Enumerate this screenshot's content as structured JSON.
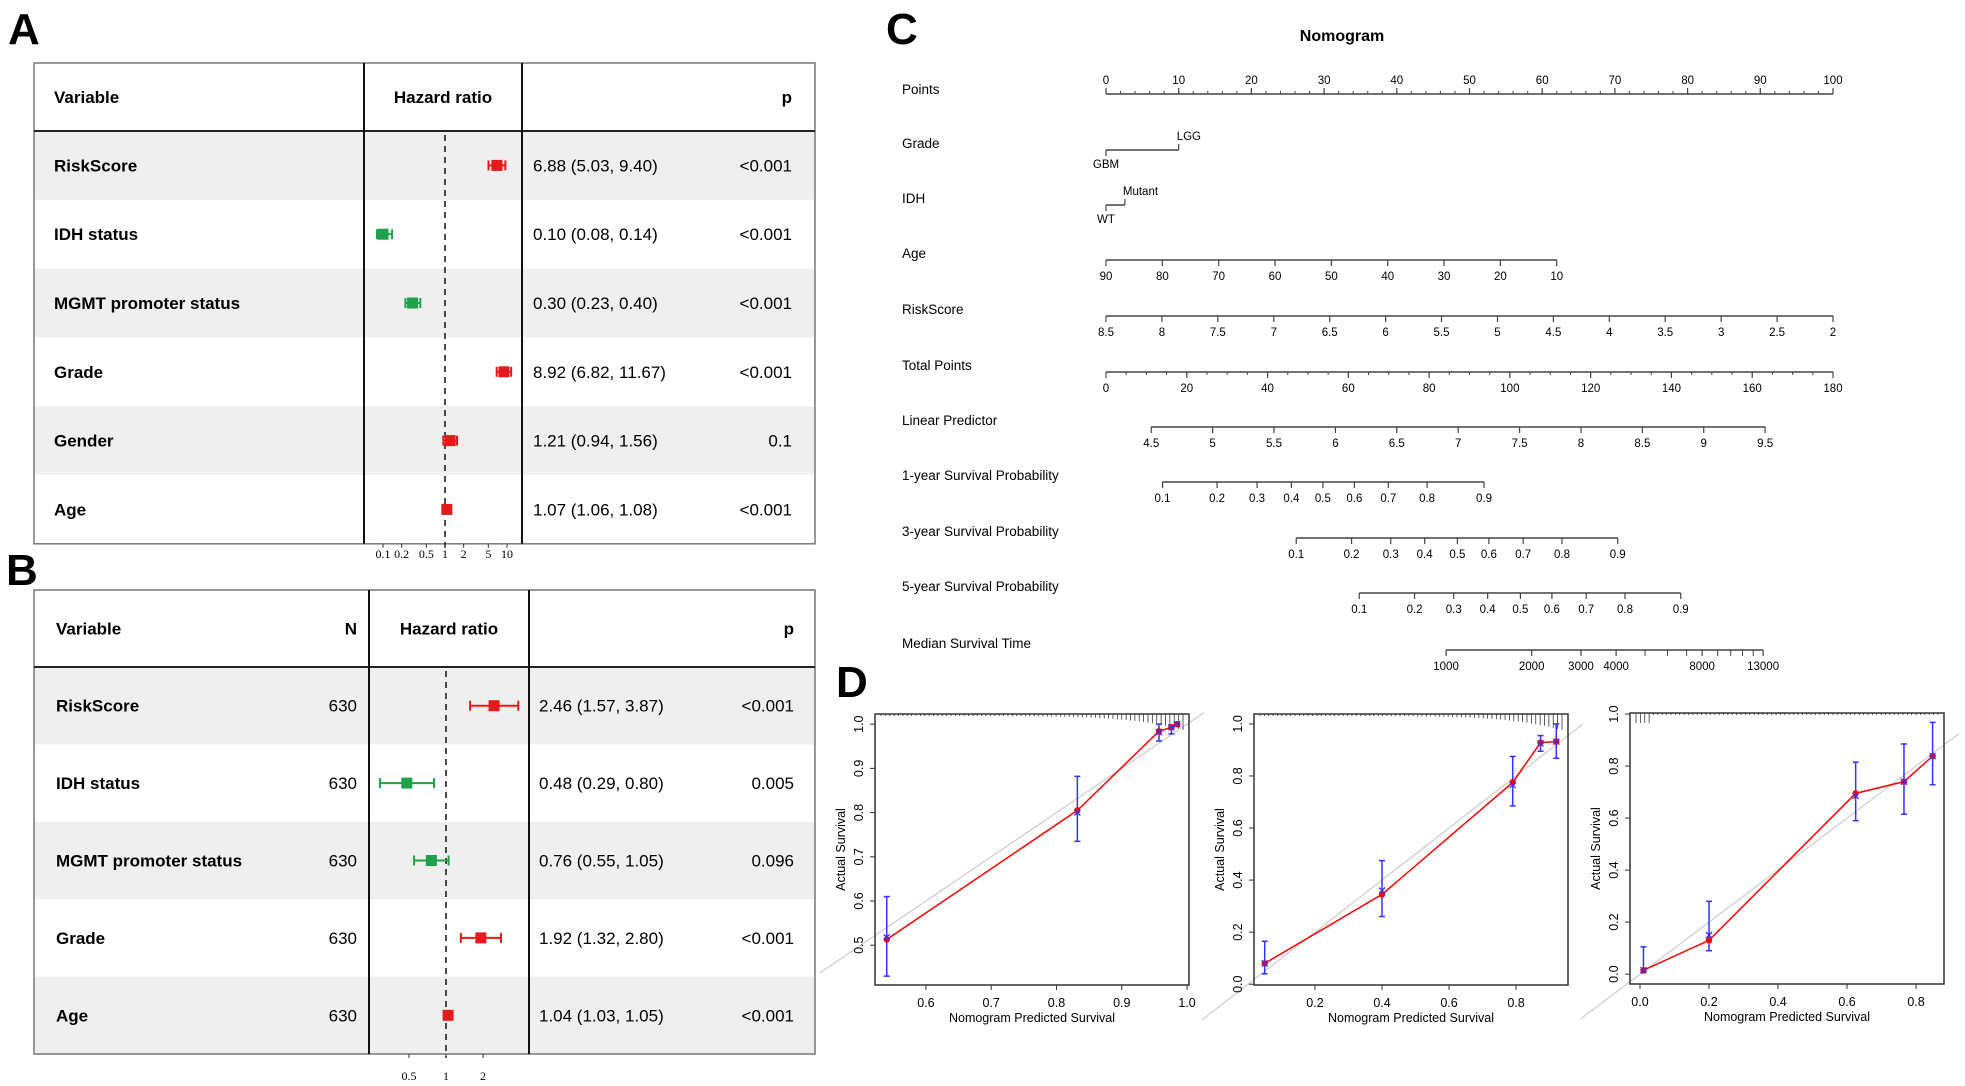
{
  "panel_labels": {
    "a": "A",
    "b": "B",
    "c": "C",
    "d": "D"
  },
  "colors": {
    "risk": "#e41a1c",
    "protective": "#1fa04a",
    "row_shade": "#efefef",
    "calib_line": "#ff0000",
    "calib_ci": "#3333ff",
    "ideal_line": "#cccccc"
  },
  "chart_data": [
    {
      "type": "forest",
      "panel": "A",
      "columns": {
        "variable": "Variable",
        "hr": "Hazard ratio",
        "p": "p"
      },
      "xscale": "log",
      "xticks": [
        0.1,
        0.2,
        0.5,
        1,
        2,
        5,
        10
      ],
      "xtick_labels": [
        "0.1",
        "0.2",
        "0.5",
        "1",
        "2",
        "5",
        "10"
      ],
      "reference": 1,
      "rows": [
        {
          "variable": "RiskScore",
          "hr": 6.88,
          "lower": 5.03,
          "upper": 9.4,
          "estimate": "6.88 (5.03, 9.40)",
          "p": "<0.001",
          "color": "#e41a1c"
        },
        {
          "variable": "IDH status",
          "hr": 0.1,
          "lower": 0.08,
          "upper": 0.14,
          "estimate": "0.10 (0.08, 0.14)",
          "p": "<0.001",
          "color": "#1fa04a"
        },
        {
          "variable": "MGMT promoter status",
          "hr": 0.3,
          "lower": 0.23,
          "upper": 0.4,
          "estimate": "0.30 (0.23, 0.40)",
          "p": "<0.001",
          "color": "#1fa04a"
        },
        {
          "variable": "Grade",
          "hr": 8.92,
          "lower": 6.82,
          "upper": 11.67,
          "estimate": "8.92 (6.82, 11.67)",
          "p": "<0.001",
          "color": "#e41a1c"
        },
        {
          "variable": "Gender",
          "hr": 1.21,
          "lower": 0.94,
          "upper": 1.56,
          "estimate": "1.21 (0.94, 1.56)",
          "p": "0.1",
          "color": "#e41a1c"
        },
        {
          "variable": "Age",
          "hr": 1.07,
          "lower": 1.06,
          "upper": 1.08,
          "estimate": "1.07 (1.06, 1.08)",
          "p": "<0.001",
          "color": "#e41a1c"
        }
      ]
    },
    {
      "type": "forest",
      "panel": "B",
      "columns": {
        "variable": "Variable",
        "n": "N",
        "hr": "Hazard ratio",
        "p": "p"
      },
      "xscale": "log",
      "xticks": [
        0.5,
        1,
        2
      ],
      "xtick_labels": [
        "0.5",
        "1",
        "2"
      ],
      "reference": 1,
      "rows": [
        {
          "variable": "RiskScore",
          "n": "630",
          "hr": 2.46,
          "lower": 1.57,
          "upper": 3.87,
          "estimate": "2.46 (1.57, 3.87)",
          "p": "<0.001",
          "color": "#e41a1c"
        },
        {
          "variable": "IDH status",
          "n": "630",
          "hr": 0.48,
          "lower": 0.29,
          "upper": 0.8,
          "estimate": "0.48 (0.29, 0.80)",
          "p": "0.005",
          "color": "#1fa04a"
        },
        {
          "variable": "MGMT promoter status",
          "n": "630",
          "hr": 0.76,
          "lower": 0.55,
          "upper": 1.05,
          "estimate": "0.76 (0.55, 1.05)",
          "p": "0.096",
          "color": "#1fa04a"
        },
        {
          "variable": "Grade",
          "n": "630",
          "hr": 1.92,
          "lower": 1.32,
          "upper": 2.8,
          "estimate": "1.92 (1.32, 2.80)",
          "p": "<0.001",
          "color": "#e41a1c"
        },
        {
          "variable": "Age",
          "n": "630",
          "hr": 1.04,
          "lower": 1.03,
          "upper": 1.05,
          "estimate": "1.04 (1.03, 1.05)",
          "p": "<0.001",
          "color": "#e41a1c"
        }
      ]
    },
    {
      "type": "nomogram",
      "panel": "C",
      "title": "Nomogram",
      "scales": [
        {
          "label": "Points",
          "axis": "points",
          "position": "above",
          "minor_step": 2,
          "ticks": [
            {
              "t": "0",
              "pts": 0
            },
            {
              "t": "10",
              "pts": 10
            },
            {
              "t": "20",
              "pts": 20
            },
            {
              "t": "30",
              "pts": 30
            },
            {
              "t": "40",
              "pts": 40
            },
            {
              "t": "50",
              "pts": 50
            },
            {
              "t": "60",
              "pts": 60
            },
            {
              "t": "70",
              "pts": 70
            },
            {
              "t": "80",
              "pts": 80
            },
            {
              "t": "90",
              "pts": 90
            },
            {
              "t": "100",
              "pts": 100
            }
          ]
        },
        {
          "label": "Grade",
          "axis": "points",
          "position": "categorical",
          "ticks": [
            {
              "t": "GBM",
              "pts": 0,
              "side": "below"
            },
            {
              "t": "LGG",
              "pts": 10,
              "side": "above"
            }
          ]
        },
        {
          "label": "IDH",
          "axis": "points",
          "position": "categorical",
          "ticks": [
            {
              "t": "WT",
              "pts": 0,
              "side": "below"
            },
            {
              "t": "Mutant",
              "pts": 2.6,
              "side": "above"
            }
          ]
        },
        {
          "label": "Age",
          "axis": "points",
          "position": "below",
          "ticks": [
            {
              "t": "90",
              "pts": 0
            },
            {
              "t": "80",
              "pts": 7.75
            },
            {
              "t": "70",
              "pts": 15.5
            },
            {
              "t": "60",
              "pts": 23.25
            },
            {
              "t": "50",
              "pts": 31
            },
            {
              "t": "40",
              "pts": 38.75
            },
            {
              "t": "30",
              "pts": 46.5
            },
            {
              "t": "20",
              "pts": 54.25
            },
            {
              "t": "10",
              "pts": 62
            }
          ]
        },
        {
          "label": "RiskScore",
          "axis": "points",
          "position": "below",
          "ticks": [
            {
              "t": "8.5",
              "pts": 0
            },
            {
              "t": "8",
              "pts": 7.69
            },
            {
              "t": "7.5",
              "pts": 15.38
            },
            {
              "t": "7",
              "pts": 23.08
            },
            {
              "t": "6.5",
              "pts": 30.77
            },
            {
              "t": "6",
              "pts": 38.46
            },
            {
              "t": "5.5",
              "pts": 46.15
            },
            {
              "t": "5",
              "pts": 53.85
            },
            {
              "t": "4.5",
              "pts": 61.54
            },
            {
              "t": "4",
              "pts": 69.23
            },
            {
              "t": "3.5",
              "pts": 76.92
            },
            {
              "t": "3",
              "pts": 84.62
            },
            {
              "t": "2.5",
              "pts": 92.31
            },
            {
              "t": "2",
              "pts": 100
            }
          ]
        },
        {
          "label": "Total Points",
          "axis": "total",
          "position": "below",
          "minor_step": 5,
          "ticks": [
            {
              "t": "0",
              "pts": 0
            },
            {
              "t": "20",
              "pts": 20
            },
            {
              "t": "40",
              "pts": 40
            },
            {
              "t": "60",
              "pts": 60
            },
            {
              "t": "80",
              "pts": 80
            },
            {
              "t": "100",
              "pts": 100
            },
            {
              "t": "120",
              "pts": 120
            },
            {
              "t": "140",
              "pts": 140
            },
            {
              "t": "160",
              "pts": 160
            },
            {
              "t": "180",
              "pts": 180
            }
          ]
        },
        {
          "label": "Linear Predictor",
          "axis": "total",
          "position": "below",
          "ticks": [
            {
              "t": "4.5",
              "pts": 11.2
            },
            {
              "t": "5",
              "pts": 26.4
            },
            {
              "t": "5.5",
              "pts": 41.6
            },
            {
              "t": "6",
              "pts": 56.8
            },
            {
              "t": "6.5",
              "pts": 72
            },
            {
              "t": "7",
              "pts": 87.2
            },
            {
              "t": "7.5",
              "pts": 102.4
            },
            {
              "t": "8",
              "pts": 117.6
            },
            {
              "t": "8.5",
              "pts": 132.8
            },
            {
              "t": "9",
              "pts": 148
            },
            {
              "t": "9.5",
              "pts": 163.2
            }
          ]
        },
        {
          "label": "1-year Survival Probability",
          "axis": "total",
          "position": "below",
          "ticks": [
            {
              "t": "0.1",
              "pts": 14
            },
            {
              "t": "0.2",
              "pts": 27.5
            },
            {
              "t": "0.3",
              "pts": 37.4
            },
            {
              "t": "0.4",
              "pts": 45.9
            },
            {
              "t": "0.5",
              "pts": 53.7
            },
            {
              "t": "0.6",
              "pts": 61.5
            },
            {
              "t": "0.7",
              "pts": 69.9
            },
            {
              "t": "0.8",
              "pts": 79.5
            },
            {
              "t": "0.9",
              "pts": 93.6
            }
          ]
        },
        {
          "label": "3-year Survival Probability",
          "axis": "total",
          "position": "below",
          "ticks": [
            {
              "t": "0.1",
              "pts": 47.1
            },
            {
              "t": "0.2",
              "pts": 60.8
            },
            {
              "t": "0.3",
              "pts": 70.5
            },
            {
              "t": "0.4",
              "pts": 78.9
            },
            {
              "t": "0.5",
              "pts": 87
            },
            {
              "t": "0.6",
              "pts": 94.8
            },
            {
              "t": "0.7",
              "pts": 103.3
            },
            {
              "t": "0.8",
              "pts": 112.9
            },
            {
              "t": "0.9",
              "pts": 126.7
            }
          ]
        },
        {
          "label": "5-year Survival Probability",
          "axis": "total",
          "position": "below",
          "ticks": [
            {
              "t": "0.1",
              "pts": 62.7
            },
            {
              "t": "0.2",
              "pts": 76.4
            },
            {
              "t": "0.3",
              "pts": 86.1
            },
            {
              "t": "0.4",
              "pts": 94.5
            },
            {
              "t": "0.5",
              "pts": 102.6
            },
            {
              "t": "0.6",
              "pts": 110.4
            },
            {
              "t": "0.7",
              "pts": 118.9
            },
            {
              "t": "0.8",
              "pts": 128.5
            },
            {
              "t": "0.9",
              "pts": 142.3
            }
          ]
        },
        {
          "label": "Median Survival Time",
          "axis": "total",
          "position": "below",
          "ticks": [
            {
              "t": "1000",
              "pts": 84.2
            },
            {
              "t": "2000",
              "pts": 105.4
            },
            {
              "t": "3000",
              "pts": 117.6
            },
            {
              "t": "4000",
              "pts": 126.3
            },
            {
              "t": "8000",
              "pts": 147.6
            },
            {
              "t": "13000",
              "pts": 162.7
            }
          ],
          "minor_values": [
            5000,
            6000,
            7000,
            9000,
            10000,
            11000,
            12000
          ]
        }
      ]
    },
    {
      "type": "scatter",
      "panel": "D",
      "xlabel": "Nomogram Predicted Survival",
      "ylabel": "Actual Survival",
      "xlim": [
        0.522,
        1.003
      ],
      "ylim": [
        0.41,
        1.023
      ],
      "xticks": [
        "0.6",
        "0.7",
        "0.8",
        "0.9",
        "1.0"
      ],
      "yticks": [
        "0.5",
        "0.6",
        "0.7",
        "0.8",
        "0.9",
        "1.0"
      ],
      "points": [
        {
          "predicted": 0.54,
          "observed": 0.513,
          "corrected": 0.518,
          "ci": [
            0.43,
            0.61
          ]
        },
        {
          "predicted": 0.832,
          "observed": 0.805,
          "corrected": 0.8,
          "ci": [
            0.735,
            0.882
          ]
        },
        {
          "predicted": 0.957,
          "observed": 0.984,
          "corrected": 0.982,
          "ci": [
            0.962,
            1.0
          ]
        },
        {
          "predicted": 0.976,
          "observed": 0.993,
          "corrected": 0.993,
          "ci": [
            0.978,
            0.998
          ]
        },
        {
          "predicted": 0.985,
          "observed": 1.0,
          "corrected": 1.0,
          "ci": [
            1.0,
            1.0
          ]
        }
      ]
    },
    {
      "type": "scatter",
      "panel": "D",
      "xlabel": "Nomogram Predicted Survival",
      "ylabel": "Actual Survival",
      "xlim": [
        0.018,
        0.955
      ],
      "ylim": [
        -0.003,
        1.038
      ],
      "xticks": [
        "0.2",
        "0.4",
        "0.6",
        "0.8"
      ],
      "yticks": [
        "0.0",
        "0.2",
        "0.4",
        "0.6",
        "0.8",
        "1.0"
      ],
      "points": [
        {
          "predicted": 0.05,
          "observed": 0.08,
          "corrected": 0.08,
          "ci": [
            0.04,
            0.165
          ]
        },
        {
          "predicted": 0.4,
          "observed": 0.345,
          "corrected": 0.36,
          "ci": [
            0.26,
            0.475
          ]
        },
        {
          "predicted": 0.79,
          "observed": 0.775,
          "corrected": 0.765,
          "ci": [
            0.685,
            0.875
          ]
        },
        {
          "predicted": 0.873,
          "observed": 0.928,
          "corrected": 0.925,
          "ci": [
            0.895,
            0.955
          ]
        },
        {
          "predicted": 0.92,
          "observed": 0.932,
          "corrected": 0.932,
          "ci": [
            0.868,
            1.0
          ]
        }
      ]
    },
    {
      "type": "scatter",
      "panel": "D",
      "xlabel": "Nomogram Predicted Survival",
      "ylabel": "Actual Survival",
      "xlim": [
        -0.029,
        0.881
      ],
      "ylim": [
        -0.038,
        1.004
      ],
      "xticks": [
        "0.0",
        "0.2",
        "0.4",
        "0.6",
        "0.8"
      ],
      "yticks": [
        "0.0",
        "0.2",
        "0.4",
        "0.6",
        "0.8",
        "1.0"
      ],
      "points": [
        {
          "predicted": 0.01,
          "observed": 0.015,
          "corrected": 0.015,
          "ci": [
            0.005,
            0.105
          ]
        },
        {
          "predicted": 0.2,
          "observed": 0.13,
          "corrected": 0.15,
          "ci": [
            0.09,
            0.28
          ]
        },
        {
          "predicted": 0.625,
          "observed": 0.695,
          "corrected": 0.685,
          "ci": [
            0.59,
            0.815
          ]
        },
        {
          "predicted": 0.765,
          "observed": 0.74,
          "corrected": 0.74,
          "ci": [
            0.615,
            0.885
          ]
        },
        {
          "predicted": 0.848,
          "observed": 0.838,
          "corrected": 0.838,
          "ci": [
            0.728,
            0.968
          ]
        }
      ]
    }
  ]
}
